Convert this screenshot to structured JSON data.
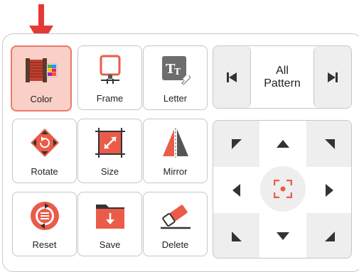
{
  "toolbar": {
    "buttons": [
      {
        "label": "Color",
        "icon": "thread-spool-palette-icon",
        "selected": true
      },
      {
        "label": "Frame",
        "icon": "embroidery-frame-icon"
      },
      {
        "label": "Letter",
        "icon": "letter-text-icon"
      },
      {
        "label": "Rotate",
        "icon": "rotate-icon"
      },
      {
        "label": "Size",
        "icon": "resize-icon"
      },
      {
        "label": "Mirror",
        "icon": "mirror-icon"
      },
      {
        "label": "Reset",
        "icon": "reset-icon"
      },
      {
        "label": "Save",
        "icon": "save-folder-icon"
      },
      {
        "label": "Delete",
        "icon": "eraser-icon"
      }
    ]
  },
  "pattern": {
    "line1": "All",
    "line2": "Pattern",
    "prev_icon": "skip-previous-icon",
    "next_icon": "skip-next-icon"
  },
  "dpad": {
    "center_icon": "center-focus-icon",
    "arrows": [
      "up-left",
      "up",
      "up-right",
      "left",
      "right",
      "down-left",
      "down",
      "down-right"
    ]
  },
  "colors": {
    "accent": "#ea5c49",
    "selected_bg": "#f9cfc7",
    "dark_icon": "#333333",
    "cell_gray": "#eeeeee"
  }
}
